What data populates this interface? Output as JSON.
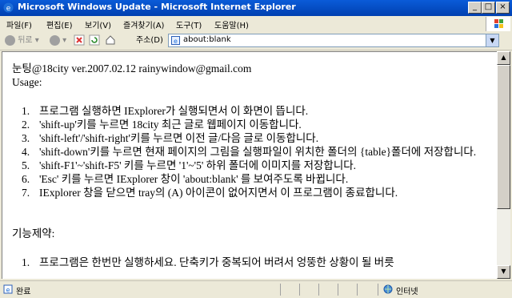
{
  "window": {
    "title": "Microsoft Windows Update - Microsoft Internet Explorer",
    "minimize": "_",
    "maximize": "□",
    "close": "×"
  },
  "menu": {
    "items": [
      "파일(F)",
      "편집(E)",
      "보기(V)",
      "즐겨찾기(A)",
      "도구(T)",
      "도움말(H)"
    ]
  },
  "toolbar": {
    "back_label": "뒤로",
    "address_label": "주소(D)",
    "address_value": "about:blank",
    "icons": [
      "back-icon",
      "forward-icon",
      "stop-icon",
      "refresh-icon",
      "home-icon"
    ]
  },
  "content": {
    "header_line": "눈팅@18city ver.2007.02.12 rainywindow@gmail.com",
    "usage_label": "Usage:",
    "usage_items": [
      {
        "num": "1.",
        "text": "프로그램 실행하면 IExplorer가 실행되면서 이 화면이 뜹니다."
      },
      {
        "num": "2.",
        "text": "'shift-up'키를 누르면 18city 최근 글로 웹페이지 이동합니다."
      },
      {
        "num": "3.",
        "text": "'shift-left'/'shift-right'키를 누르면 이전 글/다음 글로 이동합니다."
      },
      {
        "num": "4.",
        "text": "'shift-down'키를 누르면 현재 페이지의 그림을 실행파일이 위치한 폴더의 {table}폴더에 저장합니다."
      },
      {
        "num": "5.",
        "text": "'shift-F1'~'shift-F5' 키를 누르면 '1'~'5' 하위 폴더에 이미지를 저장합니다."
      },
      {
        "num": "6.",
        "text": "'Esc' 키를 누르면 IExplorer 창이 'about:blank' 를 보여주도록 바뀝니다."
      },
      {
        "num": "7.",
        "text": "IExplorer 창을 닫으면 tray의 (A) 아이콘이 없어지면서 이 프로그램이 종료합니다."
      }
    ],
    "limit_label": "기능제약:",
    "limit_items": [
      {
        "num": "1.",
        "text": "프로그램은 한번만 실행하세요. 단축키가 중복되어 버려서 엉뚱한 상황이 될 버릇"
      }
    ]
  },
  "status": {
    "text": "완료",
    "zone": "인터넷"
  },
  "colors": {
    "title_bar": "#0a5bd8",
    "chrome": "#ece9d8"
  }
}
